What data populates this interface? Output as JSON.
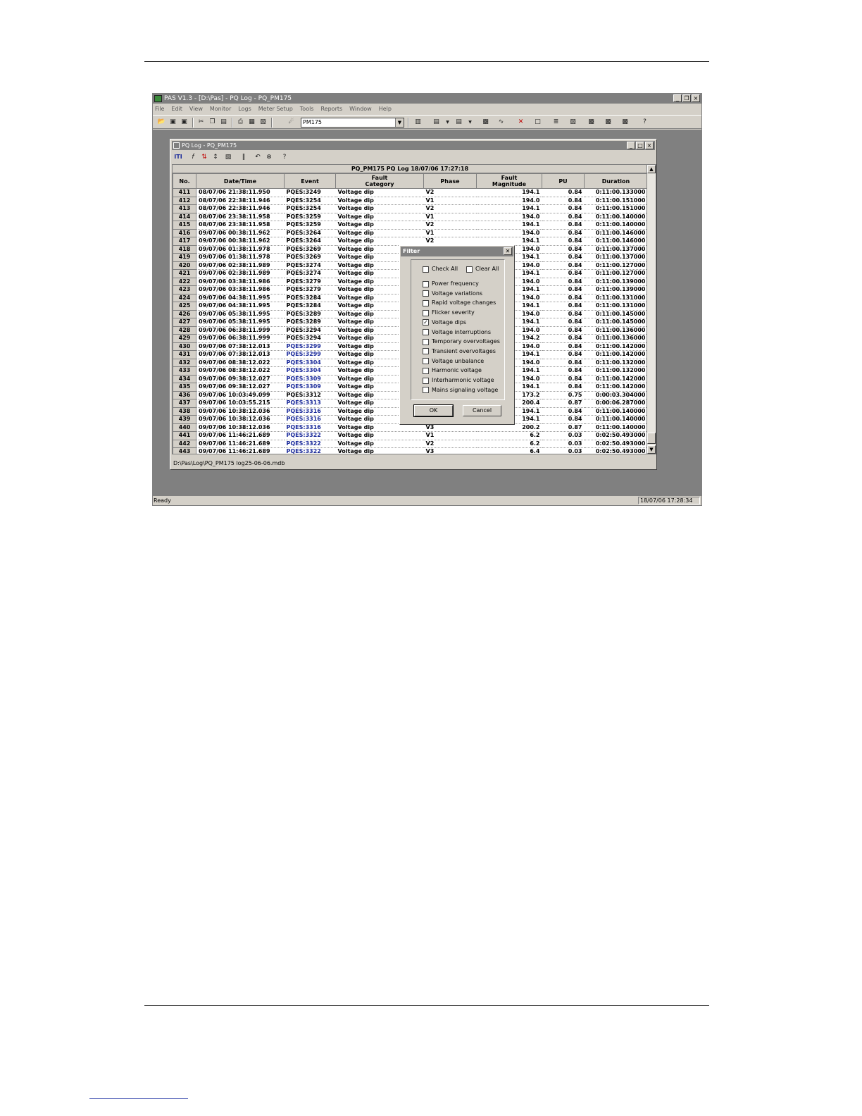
{
  "app": {
    "title": "PAS V1.3 - [D:\\Pas] - PQ Log - PQ_PM175",
    "menu": [
      "File",
      "Edit",
      "View",
      "Monitor",
      "Logs",
      "Meter Setup",
      "Tools",
      "Reports",
      "Window",
      "Help"
    ],
    "meter_select": "PM175",
    "status_text": "Ready",
    "status_time": "18/07/06 17:28:34",
    "win_buttons": [
      "_",
      "❐",
      "×"
    ]
  },
  "child": {
    "title": "PQ Log - PQ_PM175",
    "win_buttons": [
      "_",
      "□",
      "×"
    ],
    "toolbar_iti": "ITI",
    "grid_title": "PQ_PM175  PQ Log  18/07/06 17:27:18",
    "columns": [
      "No.",
      "Date/Time",
      "Event",
      "Fault Category",
      "Phase",
      "Fault Magnitude",
      "PU",
      "Duration"
    ],
    "rows": [
      {
        "no": "411",
        "dt": "08/07/06 21:38:11.950",
        "ev": "PQES:3249",
        "cat": "Voltage dip",
        "ph": "V2",
        "mag": "194.1",
        "pu": "0.84",
        "dur": "0:11:00.133000",
        "link": false
      },
      {
        "no": "412",
        "dt": "08/07/06 22:38:11.946",
        "ev": "PQES:3254",
        "cat": "Voltage dip",
        "ph": "V1",
        "mag": "194.0",
        "pu": "0.84",
        "dur": "0:11:00.151000",
        "link": false
      },
      {
        "no": "413",
        "dt": "08/07/06 22:38:11.946",
        "ev": "PQES:3254",
        "cat": "Voltage dip",
        "ph": "V2",
        "mag": "194.1",
        "pu": "0.84",
        "dur": "0:11:00.151000",
        "link": false
      },
      {
        "no": "414",
        "dt": "08/07/06 23:38:11.958",
        "ev": "PQES:3259",
        "cat": "Voltage dip",
        "ph": "V1",
        "mag": "194.0",
        "pu": "0.84",
        "dur": "0:11:00.140000",
        "link": false
      },
      {
        "no": "415",
        "dt": "08/07/06 23:38:11.958",
        "ev": "PQES:3259",
        "cat": "Voltage dip",
        "ph": "V2",
        "mag": "194.1",
        "pu": "0.84",
        "dur": "0:11:00.140000",
        "link": false
      },
      {
        "no": "416",
        "dt": "09/07/06 00:38:11.962",
        "ev": "PQES:3264",
        "cat": "Voltage dip",
        "ph": "V1",
        "mag": "194.0",
        "pu": "0.84",
        "dur": "0:11:00.146000",
        "link": false
      },
      {
        "no": "417",
        "dt": "09/07/06 00:38:11.962",
        "ev": "PQES:3264",
        "cat": "Voltage dip",
        "ph": "V2",
        "mag": "194.1",
        "pu": "0.84",
        "dur": "0:11:00.146000",
        "link": false
      },
      {
        "no": "418",
        "dt": "09/07/06 01:38:11.978",
        "ev": "PQES:3269",
        "cat": "Voltage dip",
        "ph": "",
        "mag": "194.0",
        "pu": "0.84",
        "dur": "0:11:00.137000",
        "link": false
      },
      {
        "no": "419",
        "dt": "09/07/06 01:38:11.978",
        "ev": "PQES:3269",
        "cat": "Voltage dip",
        "ph": "",
        "mag": "194.1",
        "pu": "0.84",
        "dur": "0:11:00.137000",
        "link": false
      },
      {
        "no": "420",
        "dt": "09/07/06 02:38:11.989",
        "ev": "PQES:3274",
        "cat": "Voltage dip",
        "ph": "",
        "mag": "194.0",
        "pu": "0.84",
        "dur": "0:11:00.127000",
        "link": false
      },
      {
        "no": "421",
        "dt": "09/07/06 02:38:11.989",
        "ev": "PQES:3274",
        "cat": "Voltage dip",
        "ph": "",
        "mag": "194.1",
        "pu": "0.84",
        "dur": "0:11:00.127000",
        "link": false
      },
      {
        "no": "422",
        "dt": "09/07/06 03:38:11.986",
        "ev": "PQES:3279",
        "cat": "Voltage dip",
        "ph": "",
        "mag": "194.0",
        "pu": "0.84",
        "dur": "0:11:00.139000",
        "link": false
      },
      {
        "no": "423",
        "dt": "09/07/06 03:38:11.986",
        "ev": "PQES:3279",
        "cat": "Voltage dip",
        "ph": "",
        "mag": "194.1",
        "pu": "0.84",
        "dur": "0:11:00.139000",
        "link": false
      },
      {
        "no": "424",
        "dt": "09/07/06 04:38:11.995",
        "ev": "PQES:3284",
        "cat": "Voltage dip",
        "ph": "",
        "mag": "194.0",
        "pu": "0.84",
        "dur": "0:11:00.131000",
        "link": false
      },
      {
        "no": "425",
        "dt": "09/07/06 04:38:11.995",
        "ev": "PQES:3284",
        "cat": "Voltage dip",
        "ph": "",
        "mag": "194.1",
        "pu": "0.84",
        "dur": "0:11:00.131000",
        "link": false
      },
      {
        "no": "426",
        "dt": "09/07/06 05:38:11.995",
        "ev": "PQES:3289",
        "cat": "Voltage dip",
        "ph": "",
        "mag": "194.0",
        "pu": "0.84",
        "dur": "0:11:00.145000",
        "link": false
      },
      {
        "no": "427",
        "dt": "09/07/06 05:38:11.995",
        "ev": "PQES:3289",
        "cat": "Voltage dip",
        "ph": "",
        "mag": "194.1",
        "pu": "0.84",
        "dur": "0:11:00.145000",
        "link": false
      },
      {
        "no": "428",
        "dt": "09/07/06 06:38:11.999",
        "ev": "PQES:3294",
        "cat": "Voltage dip",
        "ph": "",
        "mag": "194.0",
        "pu": "0.84",
        "dur": "0:11:00.136000",
        "link": false
      },
      {
        "no": "429",
        "dt": "09/07/06 06:38:11.999",
        "ev": "PQES:3294",
        "cat": "Voltage dip",
        "ph": "",
        "mag": "194.2",
        "pu": "0.84",
        "dur": "0:11:00.136000",
        "link": false
      },
      {
        "no": "430",
        "dt": "09/07/06 07:38:12.013",
        "ev": "PQES:3299",
        "cat": "Voltage dip",
        "ph": "",
        "mag": "194.0",
        "pu": "0.84",
        "dur": "0:11:00.142000",
        "link": true
      },
      {
        "no": "431",
        "dt": "09/07/06 07:38:12.013",
        "ev": "PQES:3299",
        "cat": "Voltage dip",
        "ph": "",
        "mag": "194.1",
        "pu": "0.84",
        "dur": "0:11:00.142000",
        "link": true
      },
      {
        "no": "432",
        "dt": "09/07/06 08:38:12.022",
        "ev": "PQES:3304",
        "cat": "Voltage dip",
        "ph": "",
        "mag": "194.0",
        "pu": "0.84",
        "dur": "0:11:00.132000",
        "link": true
      },
      {
        "no": "433",
        "dt": "09/07/06 08:38:12.022",
        "ev": "PQES:3304",
        "cat": "Voltage dip",
        "ph": "",
        "mag": "194.1",
        "pu": "0.84",
        "dur": "0:11:00.132000",
        "link": true
      },
      {
        "no": "434",
        "dt": "09/07/06 09:38:12.027",
        "ev": "PQES:3309",
        "cat": "Voltage dip",
        "ph": "",
        "mag": "194.0",
        "pu": "0.84",
        "dur": "0:11:00.142000",
        "link": true
      },
      {
        "no": "435",
        "dt": "09/07/06 09:38:12.027",
        "ev": "PQES:3309",
        "cat": "Voltage dip",
        "ph": "",
        "mag": "194.1",
        "pu": "0.84",
        "dur": "0:11:00.142000",
        "link": true
      },
      {
        "no": "436",
        "dt": "09/07/06 10:03:49.099",
        "ev": "PQES:3312",
        "cat": "Voltage dip",
        "ph": "",
        "mag": "173.2",
        "pu": "0.75",
        "dur": "0:00:03.304000",
        "link": false
      },
      {
        "no": "437",
        "dt": "09/07/06 10:03:55.215",
        "ev": "PQES:3313",
        "cat": "Voltage dip",
        "ph": "",
        "mag": "200.4",
        "pu": "0.87",
        "dur": "0:00:06.287000",
        "link": true
      },
      {
        "no": "438",
        "dt": "09/07/06 10:38:12.036",
        "ev": "PQES:3316",
        "cat": "Voltage dip",
        "ph": "",
        "mag": "194.1",
        "pu": "0.84",
        "dur": "0:11:00.140000",
        "link": true
      },
      {
        "no": "439",
        "dt": "09/07/06 10:38:12.036",
        "ev": "PQES:3316",
        "cat": "Voltage dip",
        "ph": "",
        "mag": "194.1",
        "pu": "0.84",
        "dur": "0:11:00.140000",
        "link": true
      },
      {
        "no": "440",
        "dt": "09/07/06 10:38:12.036",
        "ev": "PQES:3316",
        "cat": "Voltage dip",
        "ph": "V3",
        "mag": "200.2",
        "pu": "0.87",
        "dur": "0:11:00.140000",
        "link": true
      },
      {
        "no": "441",
        "dt": "09/07/06 11:46:21.689",
        "ev": "PQES:3322",
        "cat": "Voltage dip",
        "ph": "V1",
        "mag": "6.2",
        "pu": "0.03",
        "dur": "0:02:50.493000",
        "link": true
      },
      {
        "no": "442",
        "dt": "09/07/06 11:46:21.689",
        "ev": "PQES:3322",
        "cat": "Voltage dip",
        "ph": "V2",
        "mag": "6.2",
        "pu": "0.03",
        "dur": "0:02:50.493000",
        "link": true
      },
      {
        "no": "443",
        "dt": "09/07/06 11:46:21.689",
        "ev": "PQES:3322",
        "cat": "Voltage dip",
        "ph": "V3",
        "mag": "6.4",
        "pu": "0.03",
        "dur": "0:02:50.493000",
        "link": true
      }
    ],
    "status_path": "D:\\Pas\\Log\\PQ_PM175  log25-06-06.mdb"
  },
  "filter_dialog": {
    "title": "Filter",
    "check_all": "Check All",
    "clear_all": "Clear All",
    "options": [
      {
        "label": "Power frequency",
        "checked": false
      },
      {
        "label": "Voltage variations",
        "checked": false
      },
      {
        "label": "Rapid voltage changes",
        "checked": false
      },
      {
        "label": "Flicker severity",
        "checked": false
      },
      {
        "label": "Voltage dips",
        "checked": true
      },
      {
        "label": "Voltage interruptions",
        "checked": false
      },
      {
        "label": "Temporary overvoltages",
        "checked": false
      },
      {
        "label": "Transient overvoltages",
        "checked": false
      },
      {
        "label": "Voltage unbalance",
        "checked": false
      },
      {
        "label": "Harmonic voltage",
        "checked": false
      },
      {
        "label": "Interharmonic voltage",
        "checked": false
      },
      {
        "label": "Mains signaling voltage",
        "checked": false
      }
    ],
    "ok_label": "OK",
    "cancel_label": "Cancel"
  }
}
